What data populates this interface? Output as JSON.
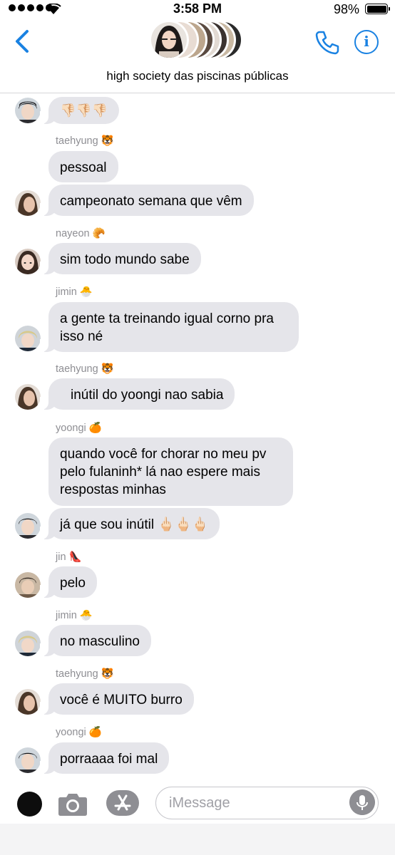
{
  "status_bar": {
    "time": "3:58 PM",
    "battery": "98%"
  },
  "header": {
    "group_name": "high society das piscinas públicas"
  },
  "composer": {
    "placeholder": "iMessage"
  },
  "colors": {
    "accent": "#1a82e2",
    "bubble_received": "#e5e5ea",
    "sender_text": "#8e8e93"
  },
  "messages": [
    {
      "text": "👎🏻👎🏻👎🏻"
    },
    {
      "sender": "taehyung 🐯",
      "text": "pessoal"
    },
    {
      "text": "campeonato semana que vêm"
    },
    {
      "sender": "nayeon 🥐",
      "text": "sim todo mundo sabe"
    },
    {
      "sender": "jimin 🐣",
      "text": "a gente ta treinando igual corno pra isso né"
    },
    {
      "sender": "taehyung 🐯",
      "text": "inútil do yoongi nao sabia"
    },
    {
      "sender": "yoongi 🍊",
      "text": "quando você for chorar no meu pv pelo fulaninh* lá nao espere mais respostas minhas"
    },
    {
      "text": "já que sou inútil 🖕🏻🖕🏻🖕🏻"
    },
    {
      "sender": "jin 👠",
      "text": "pelo"
    },
    {
      "sender": "jimin 🐣",
      "text": "no masculino"
    },
    {
      "sender": "taehyung 🐯",
      "text": "você é MUITO burro"
    },
    {
      "sender": "yoongi 🍊",
      "text": "porraaaa foi mal"
    }
  ]
}
